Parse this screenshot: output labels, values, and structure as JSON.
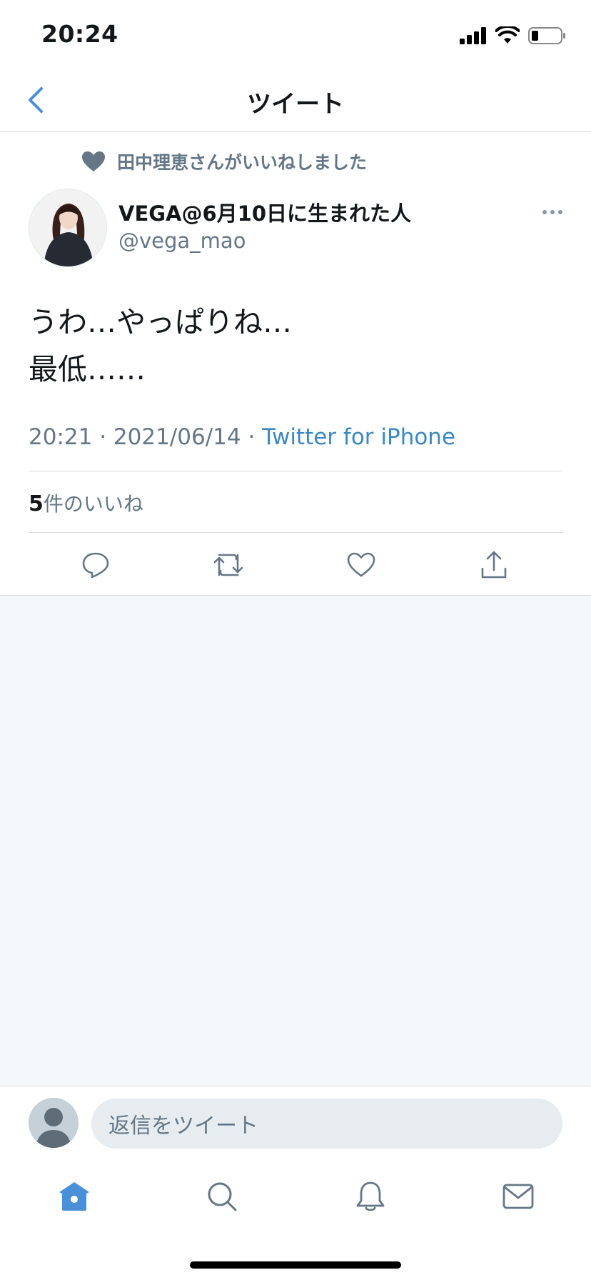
{
  "status_bar": {
    "time": "20:24"
  },
  "nav": {
    "title": "ツイート"
  },
  "social_context": {
    "text": "田中理恵さんがいいねしました"
  },
  "author": {
    "name": "VEGA@6月10日に生まれた人",
    "handle": "@vega_mao"
  },
  "tweet": {
    "text": "うわ…やっぱりね…\n最低……",
    "time": "20:21",
    "date": "2021/06/14",
    "separator": " · ",
    "source": "Twitter for iPhone"
  },
  "likes": {
    "count": "5",
    "label": "件のいいね"
  },
  "actions": [
    "reply-icon",
    "retweet-icon",
    "like-icon",
    "share-icon"
  ],
  "reply": {
    "placeholder": "返信をツイート"
  },
  "tabs": [
    "home-icon",
    "search-icon",
    "notifications-icon",
    "messages-icon"
  ],
  "colors": {
    "accent": "#4a90d9",
    "secondary_text": "#657786",
    "background": "#f5f8fa"
  }
}
